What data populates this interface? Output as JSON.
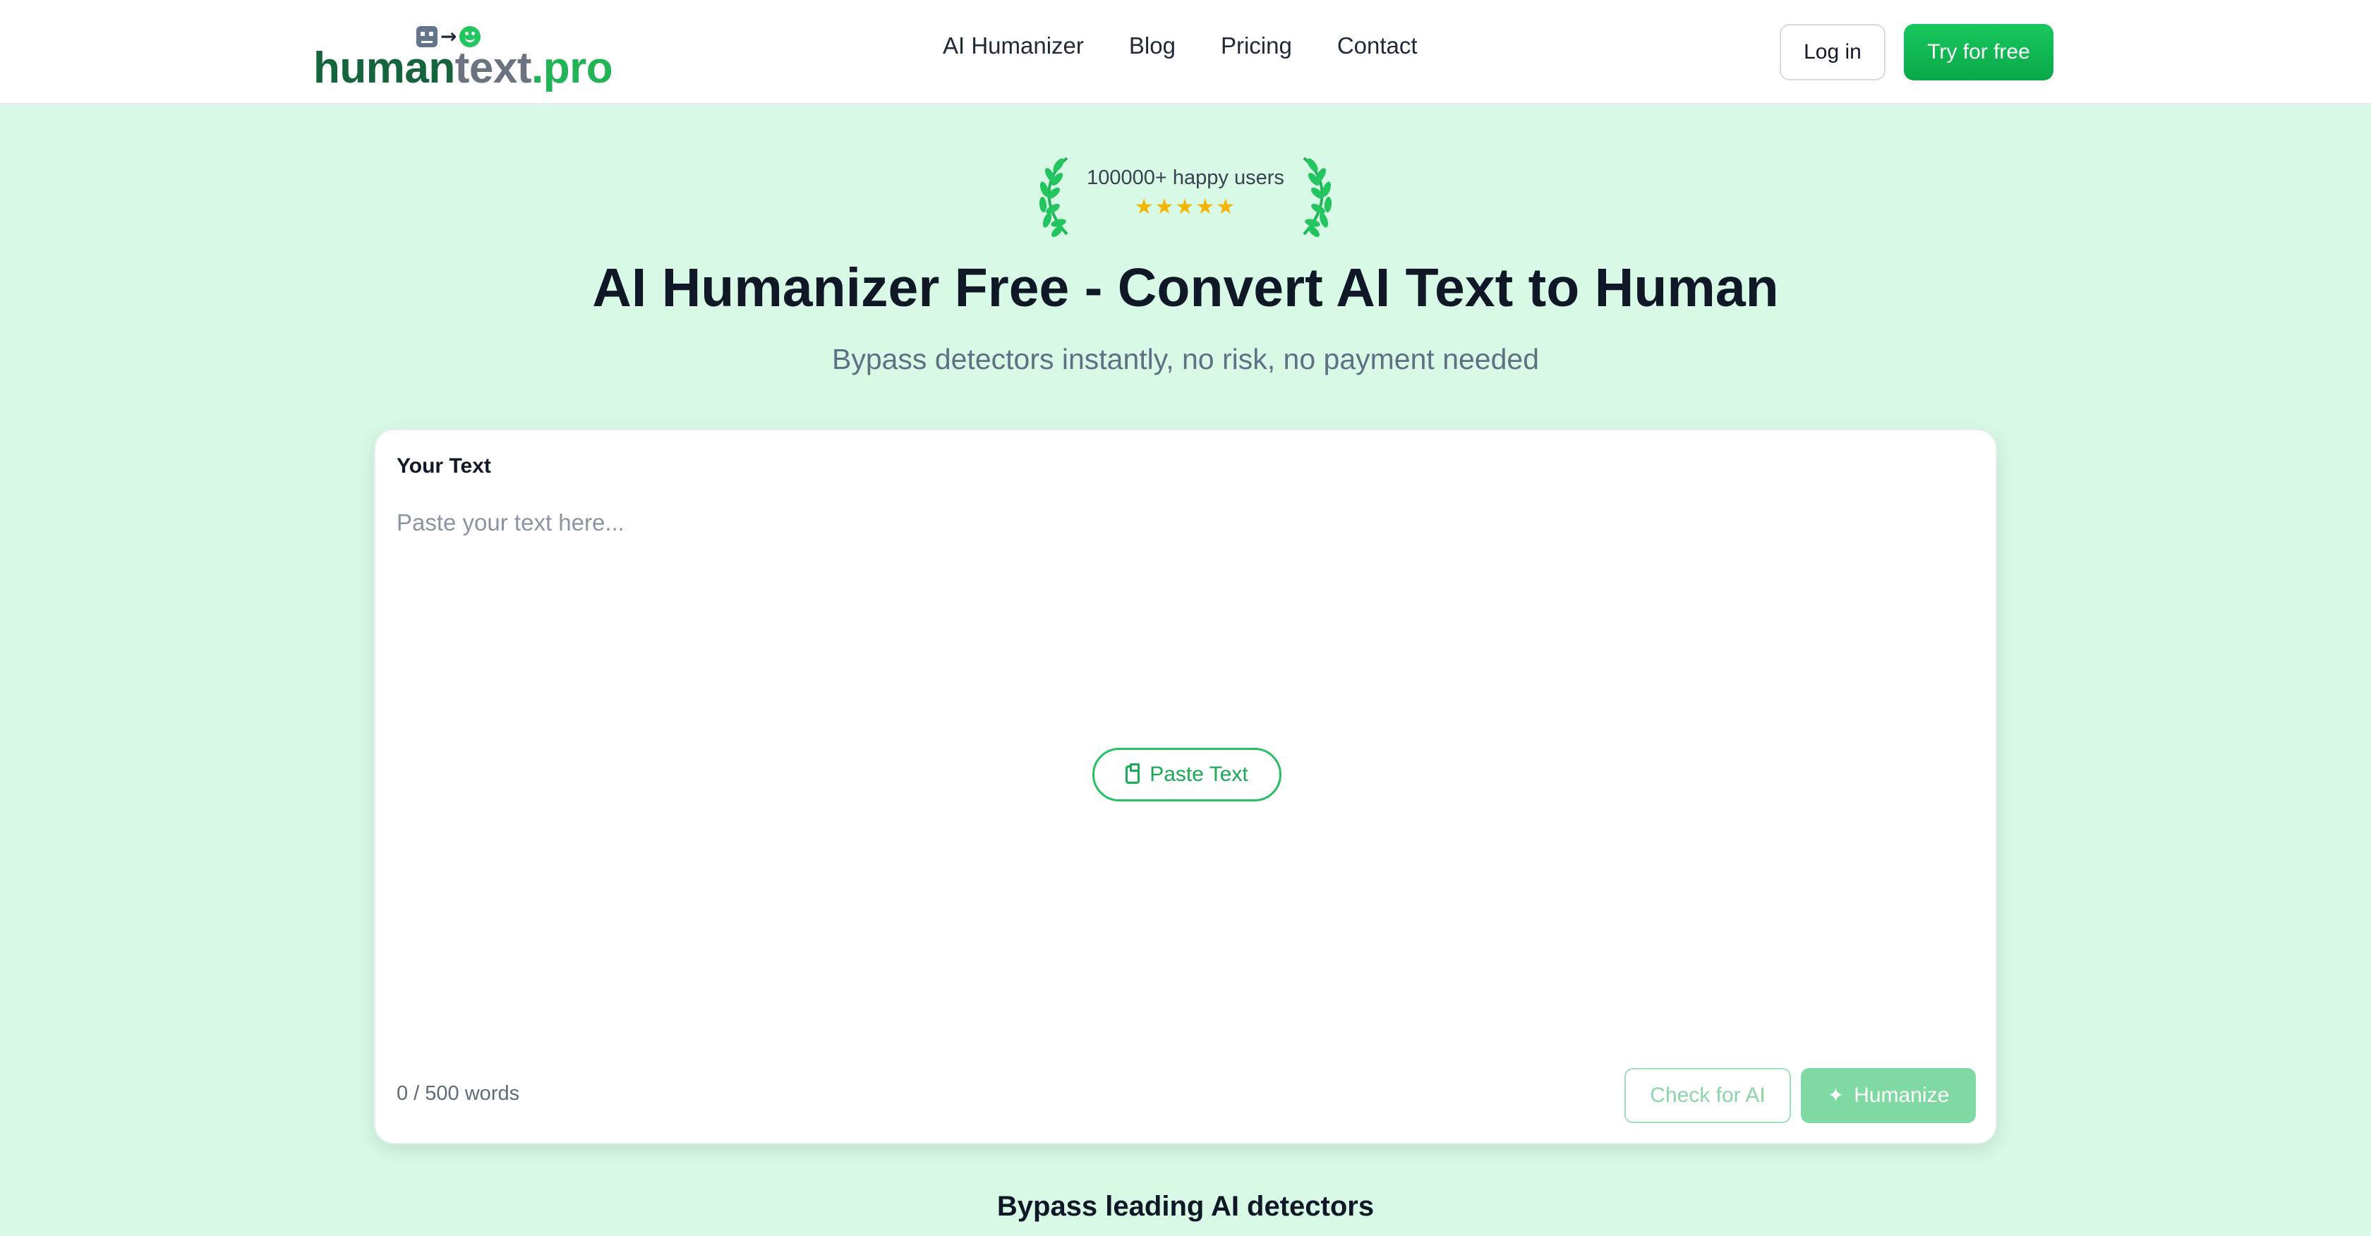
{
  "brand": {
    "logo_part1": "human",
    "logo_part2": "text",
    "logo_part3": ".pro",
    "icons": [
      "robot-face-icon",
      "arrow-right-icon",
      "smile-face-icon"
    ],
    "colors": {
      "dark_green": "#14643c",
      "gray": "#6b7280",
      "green": "#22b357"
    }
  },
  "nav": {
    "items": [
      {
        "label": "AI Humanizer"
      },
      {
        "label": "Blog"
      },
      {
        "label": "Pricing"
      },
      {
        "label": "Contact"
      }
    ]
  },
  "header": {
    "login_label": "Log in",
    "cta_label": "Try for free"
  },
  "hero": {
    "badge_text": "100000+ happy users",
    "rating_stars": "★★★★★",
    "rating": 5,
    "title": "AI Humanizer Free - Convert AI Text to Human",
    "subtitle": "Bypass detectors instantly, no risk, no payment needed"
  },
  "editor": {
    "label": "Your Text",
    "placeholder": "Paste your text here...",
    "value": "",
    "paste_button_label": "Paste Text",
    "word_count": "0 / 500 words",
    "check_button_label": "Check for AI",
    "humanize_button_label": "Humanize"
  },
  "section": {
    "title": "Bypass leading AI detectors"
  },
  "colors": {
    "page_background": "#d8f9e6",
    "accent": "#17c85c",
    "star": "#f5b400"
  }
}
